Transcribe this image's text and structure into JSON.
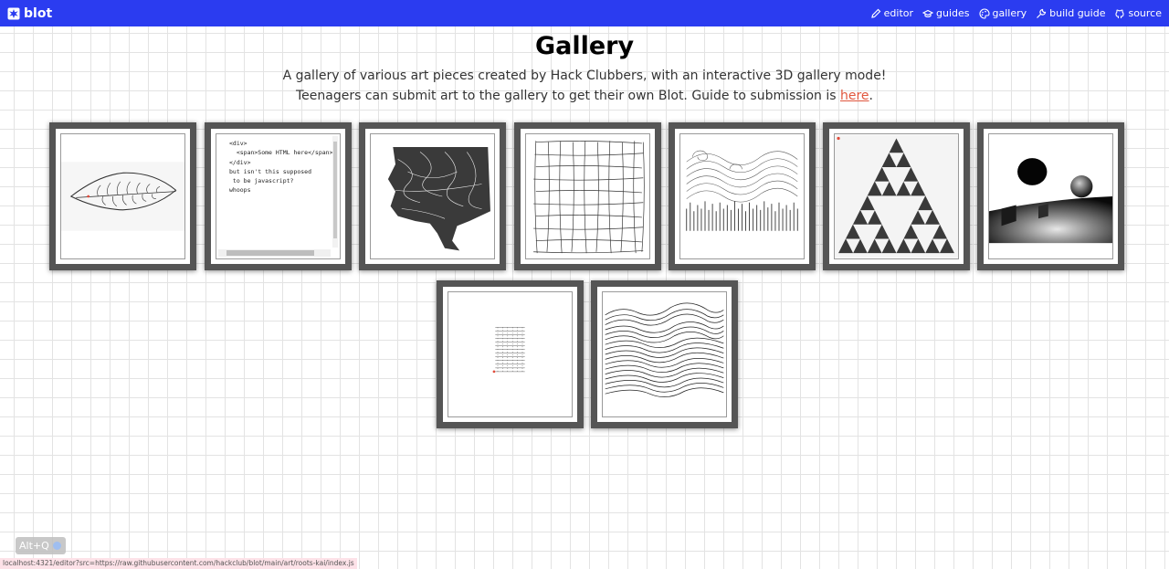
{
  "header": {
    "logo_text": "blot",
    "nav": [
      {
        "label": "editor",
        "icon": "pencil-icon"
      },
      {
        "label": "guides",
        "icon": "graduation-cap-icon"
      },
      {
        "label": "gallery",
        "icon": "palette-icon"
      },
      {
        "label": "build guide",
        "icon": "wrench-icon"
      },
      {
        "label": "source",
        "icon": "github-icon"
      }
    ],
    "colors": {
      "bar": "#2b3cf0",
      "text": "#ffffff"
    }
  },
  "page": {
    "title": "Gallery",
    "subtitle_line1": "A gallery of various art pieces created by Hack Clubbers, with an interactive 3D gallery mode!",
    "subtitle_line2": "Teenagers can submit art to the gallery to get their own Blot. Guide to submission is ",
    "link_text": "here",
    "link_after": ".",
    "link_color": "#e0563d"
  },
  "gallery": {
    "row1": [
      {
        "art": "leaf-drawing"
      },
      {
        "art": "code-text",
        "code": "<div>\n  <span>Some HTML here</span>\n</div>\nbut isn't this supposed\n to be javascript?\nwhoops"
      },
      {
        "art": "tree-drawing"
      },
      {
        "art": "wobbly-grid"
      },
      {
        "art": "wind-field"
      },
      {
        "art": "sierpinski-triangles"
      },
      {
        "art": "3d-spheres-scene"
      }
    ],
    "row2": [
      {
        "art": "tiny-glyph-grid"
      },
      {
        "art": "wave-lines"
      }
    ]
  },
  "status_bar": {
    "url": "localhost:4321/editor?src=https://raw.githubusercontent.com/hackclub/blot/main/art/roots-kai/index.js"
  },
  "overlay": {
    "label": "Alt+Q"
  }
}
